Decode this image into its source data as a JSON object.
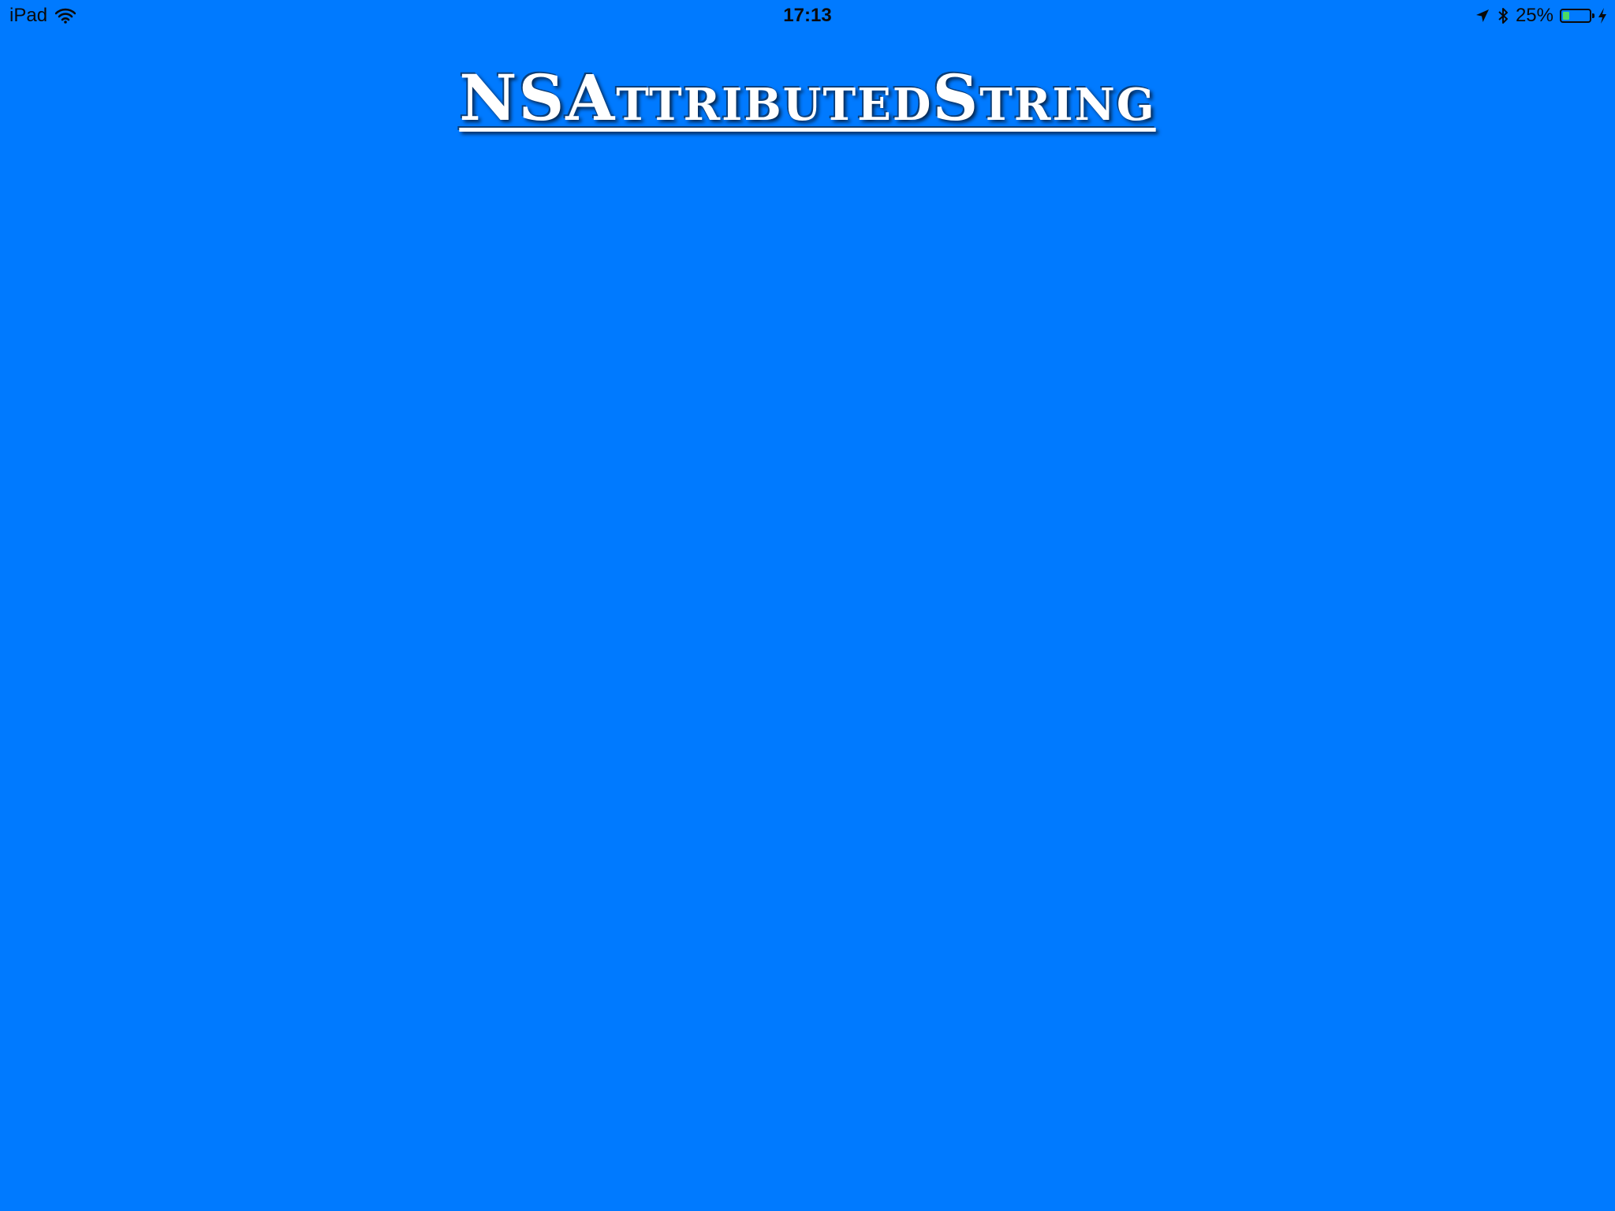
{
  "status_bar": {
    "device_label": "iPad",
    "time": "17:13",
    "battery_percent_label": "25%",
    "battery_level": 0.25,
    "icons": [
      "wifi-icon",
      "location-arrow-icon",
      "bluetooth-icon",
      "battery-icon",
      "charging-bolt-icon"
    ]
  },
  "main": {
    "title": "NSAttributedString"
  },
  "colors": {
    "background": "#007aff",
    "title_text": "#ffffff",
    "title_shadow": "#0b3f7a",
    "battery_fill": "#4cd964"
  }
}
